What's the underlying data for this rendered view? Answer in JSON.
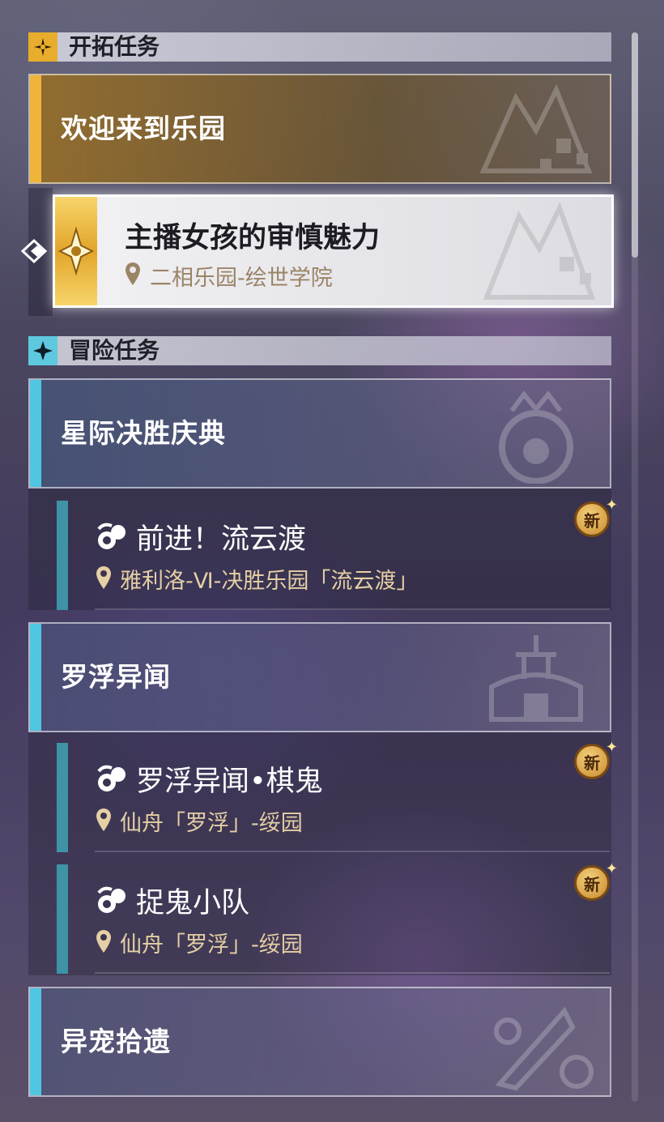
{
  "sections": [
    {
      "id": "trailblaze",
      "title": "开拓任务",
      "icon": "trailblaze-star-icon",
      "icon_bg": "#e8ad2c"
    },
    {
      "id": "adventure",
      "title": "冒险任务",
      "icon": "adventure-star-icon",
      "icon_bg": "#5ec8de"
    }
  ],
  "trailblaze": {
    "group_title": "欢迎来到乐园",
    "accent_color": "#f0b43a",
    "selected_quest": {
      "title": "主播女孩的审慎魅力",
      "location": "二相乐园-绘世学院",
      "icon": "trailblaze-mission-icon"
    }
  },
  "adventure": {
    "accent_color": "#4fc6e2",
    "groups": [
      {
        "title": "星际决胜庆典",
        "quests": [
          {
            "title": "前进！流云渡",
            "location": "雅利洛-Ⅵ-决胜乐园「流云渡」",
            "badge": "新"
          }
        ]
      },
      {
        "title": "罗浮异闻",
        "quests": [
          {
            "title": "罗浮异闻•棋鬼",
            "location": "仙舟「罗浮」-绥园",
            "badge": "新"
          },
          {
            "title": "捉鬼小队",
            "location": "仙舟「罗浮」-绥园",
            "badge": "新"
          }
        ]
      },
      {
        "title": "异宠拾遗",
        "quests": []
      }
    ]
  },
  "icons": {
    "quest_type": "adventure-mission-icon",
    "location": "location-pin-icon",
    "selection": "selection-arrow-icon",
    "new_star": "sparkle-icon"
  },
  "colors": {
    "location_text": "#e5cfa4",
    "quest_bar": "#3f93a6",
    "badge_gold": "#d89a36"
  }
}
